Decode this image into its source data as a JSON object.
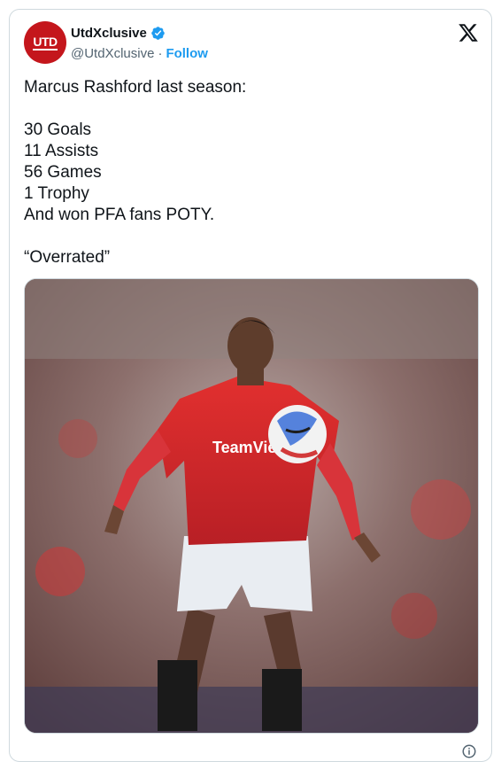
{
  "account": {
    "avatar_text": "UTD",
    "display_name": "UtdXclusive",
    "handle": "@UtdXclusive",
    "separator": "·",
    "follow_label": "Follow",
    "verified": true
  },
  "tweet": {
    "text": "Marcus Rashford last season:\n\n30 Goals\n11 Assists\n56 Games\n1 Trophy\nAnd won PFA fans POTY.\n\n“Overrated”"
  },
  "media": {
    "description_icon": "photo-player",
    "sponsor_text": "TeamViewer"
  },
  "colors": {
    "accent": "#1d9bf0",
    "avatar_bg": "#c4161c",
    "kit_red": "#d3232b",
    "text": "#0f1419",
    "secondary": "#536471"
  }
}
